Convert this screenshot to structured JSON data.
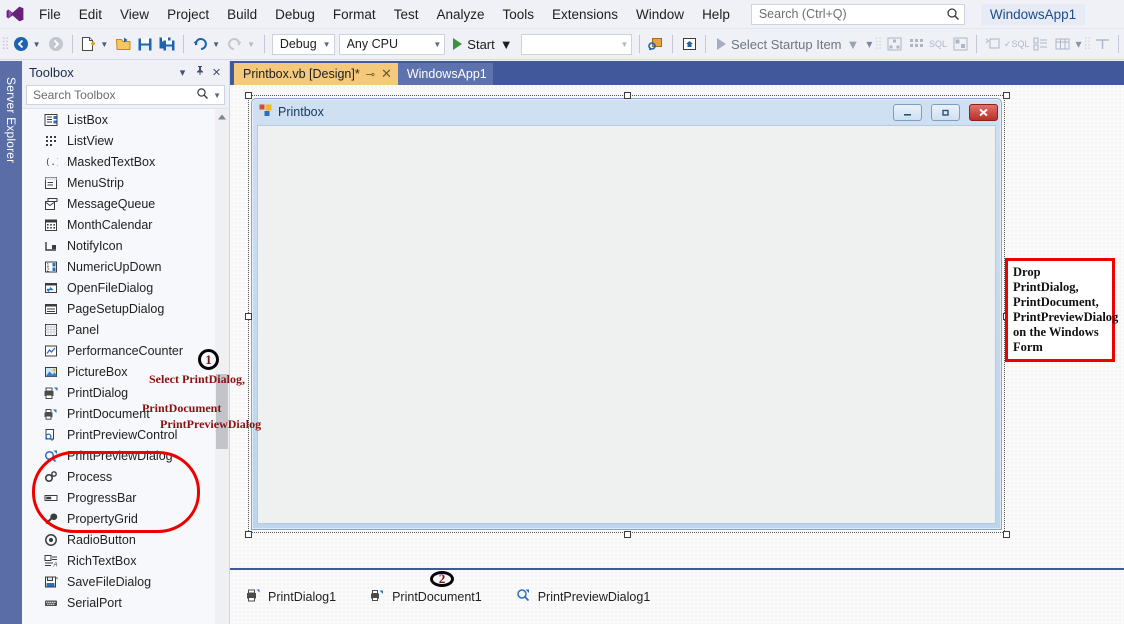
{
  "menu": {
    "logo_name": "visual-studio-logo",
    "items": [
      "File",
      "Edit",
      "View",
      "Project",
      "Build",
      "Debug",
      "Format",
      "Test",
      "Analyze",
      "Tools",
      "Extensions",
      "Window",
      "Help"
    ],
    "search_placeholder": "Search (Ctrl+Q)",
    "project_name": "WindowsApp1"
  },
  "toolbar": {
    "back_label": "back-navigate",
    "forward_label": "forward-navigate",
    "new_item_label": "new-item",
    "open_label": "open-file",
    "save_label": "save",
    "save_all_label": "save-all",
    "undo_label": "undo",
    "redo_label": "redo",
    "config_value": "Debug",
    "platform_value": "Any CPU",
    "start_label": "Start",
    "target_value": "",
    "startup_item_label": "Select Startup Item",
    "caret": "▾"
  },
  "dock": {
    "server_explorer_label": "Server Explorer"
  },
  "toolbox": {
    "title": "Toolbox",
    "search_placeholder": "Search Toolbox",
    "dropdown_glyph": "▾",
    "pin_glyph": "⏐",
    "close_glyph": "✕",
    "items": [
      {
        "label": "ListBox",
        "icon": "listbox-icon"
      },
      {
        "label": "ListView",
        "icon": "listview-icon"
      },
      {
        "label": "MaskedTextBox",
        "icon": "maskedtextbox-icon"
      },
      {
        "label": "MenuStrip",
        "icon": "menustrip-icon"
      },
      {
        "label": "MessageQueue",
        "icon": "messagequeue-icon"
      },
      {
        "label": "MonthCalendar",
        "icon": "monthcalendar-icon"
      },
      {
        "label": "NotifyIcon",
        "icon": "notifyicon-icon"
      },
      {
        "label": "NumericUpDown",
        "icon": "numericupdown-icon"
      },
      {
        "label": "OpenFileDialog",
        "icon": "openfiledialog-icon"
      },
      {
        "label": "PageSetupDialog",
        "icon": "pagesetupdialog-icon"
      },
      {
        "label": "Panel",
        "icon": "panel-icon"
      },
      {
        "label": "PerformanceCounter",
        "icon": "performancecounter-icon"
      },
      {
        "label": "PictureBox",
        "icon": "picturebox-icon"
      },
      {
        "label": "PrintDialog",
        "icon": "printdialog-icon"
      },
      {
        "label": "PrintDocument",
        "icon": "printdocument-icon"
      },
      {
        "label": "PrintPreviewControl",
        "icon": "printpreviewcontrol-icon"
      },
      {
        "label": "PrintPreviewDialog",
        "icon": "printpreviewdialog-icon"
      },
      {
        "label": "Process",
        "icon": "process-icon"
      },
      {
        "label": "ProgressBar",
        "icon": "progressbar-icon"
      },
      {
        "label": "PropertyGrid",
        "icon": "propertygrid-icon"
      },
      {
        "label": "RadioButton",
        "icon": "radiobutton-icon"
      },
      {
        "label": "RichTextBox",
        "icon": "richtextbox-icon"
      },
      {
        "label": "SaveFileDialog",
        "icon": "savefiledialog-icon"
      },
      {
        "label": "SerialPort",
        "icon": "serialport-icon"
      }
    ]
  },
  "tabs": [
    {
      "label": "Printbox.vb [Design]*",
      "active": true,
      "pin_glyph": "⊸",
      "close_glyph": "✕"
    },
    {
      "label": "WindowsApp1",
      "active": false
    }
  ],
  "form": {
    "title": "Printbox",
    "minimize_glyph": "—",
    "maximize_glyph": "□",
    "close_glyph": "✕"
  },
  "tray": {
    "items": [
      {
        "label": "PrintDialog1",
        "icon": "printdialog-icon"
      },
      {
        "label": "PrintDocument1",
        "icon": "printdocument-icon"
      },
      {
        "label": "PrintPreviewDialog1",
        "icon": "printpreviewdialog-icon"
      }
    ]
  },
  "annotations": {
    "step1": "1",
    "step2": "2",
    "select_line1": "Select PrintDialog,",
    "select_line2": "PrintDocument",
    "select_line3": "PrintPreviewDialog",
    "drop_box": "Drop PrintDialog, PrintDocument, PrintPreviewDialog on the Windows Form"
  },
  "colors": {
    "accent": "#41599b",
    "annotation_red": "#ef0000",
    "annotation_text": "#8b1012",
    "active_tab": "#f5c97c"
  }
}
